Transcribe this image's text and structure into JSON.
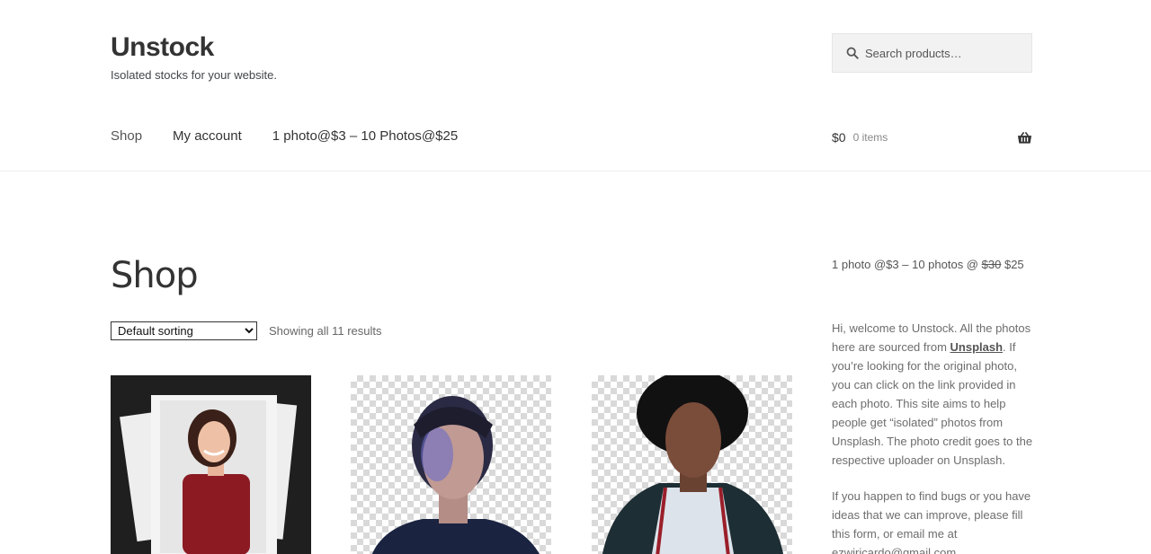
{
  "site": {
    "title": "Unstock",
    "tagline": "Isolated stocks for your website."
  },
  "search": {
    "placeholder": "Search products…"
  },
  "nav": {
    "items": [
      {
        "label": "Shop"
      },
      {
        "label": "My account"
      },
      {
        "label": "1 photo@$3 – 10 Photos@$25"
      }
    ]
  },
  "cart": {
    "amount": "$0",
    "items": "0 items"
  },
  "main": {
    "title": "Shop",
    "sort_selected": "Default sorting",
    "result_count": "Showing all 11 results"
  },
  "sidebar": {
    "promo_prefix": "1 photo @$3 – 10 photos @",
    "promo_old": "$30",
    "promo_new": "$25",
    "intro_part1": "Hi, welcome to Unstock. All the photos here are sourced from ",
    "intro_link": "Unsplash",
    "intro_part2": ". If you’re looking for the original photo, you can click on the link provided in each photo. This site aims to help people get “isolated” photos from Unsplash. The photo credit goes to the respective uploader on Unsplash.",
    "feedback": "If you happen to find bugs or you have ideas that we can improve, please fill this form, or email me at",
    "email": "ezwiricardo@gmail.com"
  },
  "colors": {
    "accent": "#333333",
    "search_bg": "#f2f2f2"
  }
}
